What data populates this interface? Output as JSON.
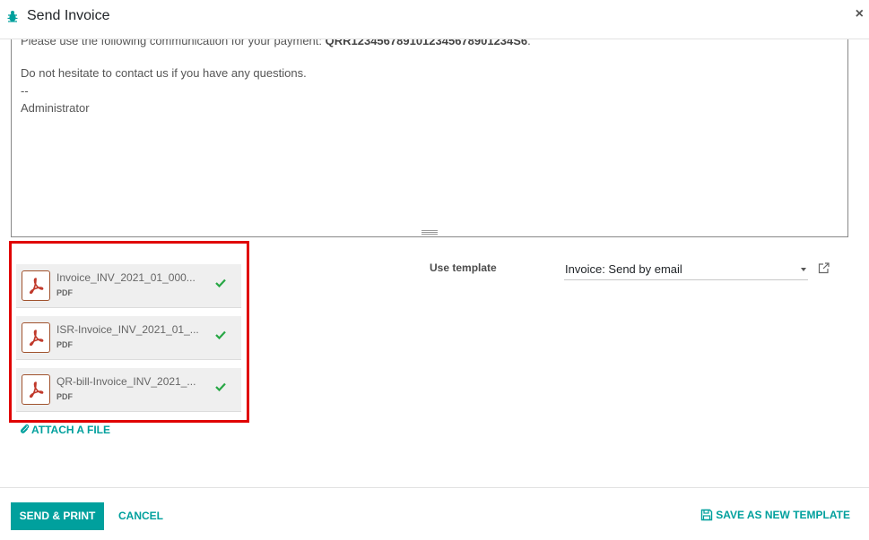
{
  "dialog": {
    "title": "Send Invoice",
    "close_glyph": "×"
  },
  "editor": {
    "cut_line_prefix": "Please use the following communication for your payment: ",
    "cut_line_ref": "QRR1234567891012345678901234S6",
    "cut_line_suffix": ".",
    "line_contact": "Do not hesitate to contact us if you have any questions.",
    "line_dashes": "--",
    "line_signature": "Administrator"
  },
  "attachments": [
    {
      "name": "Invoice_INV_2021_01_000...",
      "type": "PDF",
      "icon": "pdf-icon",
      "status_icon": "check-icon"
    },
    {
      "name": "ISR-Invoice_INV_2021_01_...",
      "type": "PDF",
      "icon": "pdf-icon",
      "status_icon": "check-icon"
    },
    {
      "name": "QR-bill-Invoice_INV_2021_...",
      "type": "PDF",
      "icon": "pdf-icon",
      "status_icon": "check-icon"
    }
  ],
  "attach_file_label": "ATTACH A FILE",
  "template": {
    "label": "Use template",
    "value": "Invoice: Send by email"
  },
  "footer": {
    "send_print_label": "SEND & PRINT",
    "cancel_label": "CANCEL",
    "save_template_label": "SAVE AS NEW TEMPLATE"
  },
  "colors": {
    "accent": "#00a09d",
    "highlight": "#e00000",
    "pdf_icon": "#a0522d",
    "check": "#28a745"
  }
}
